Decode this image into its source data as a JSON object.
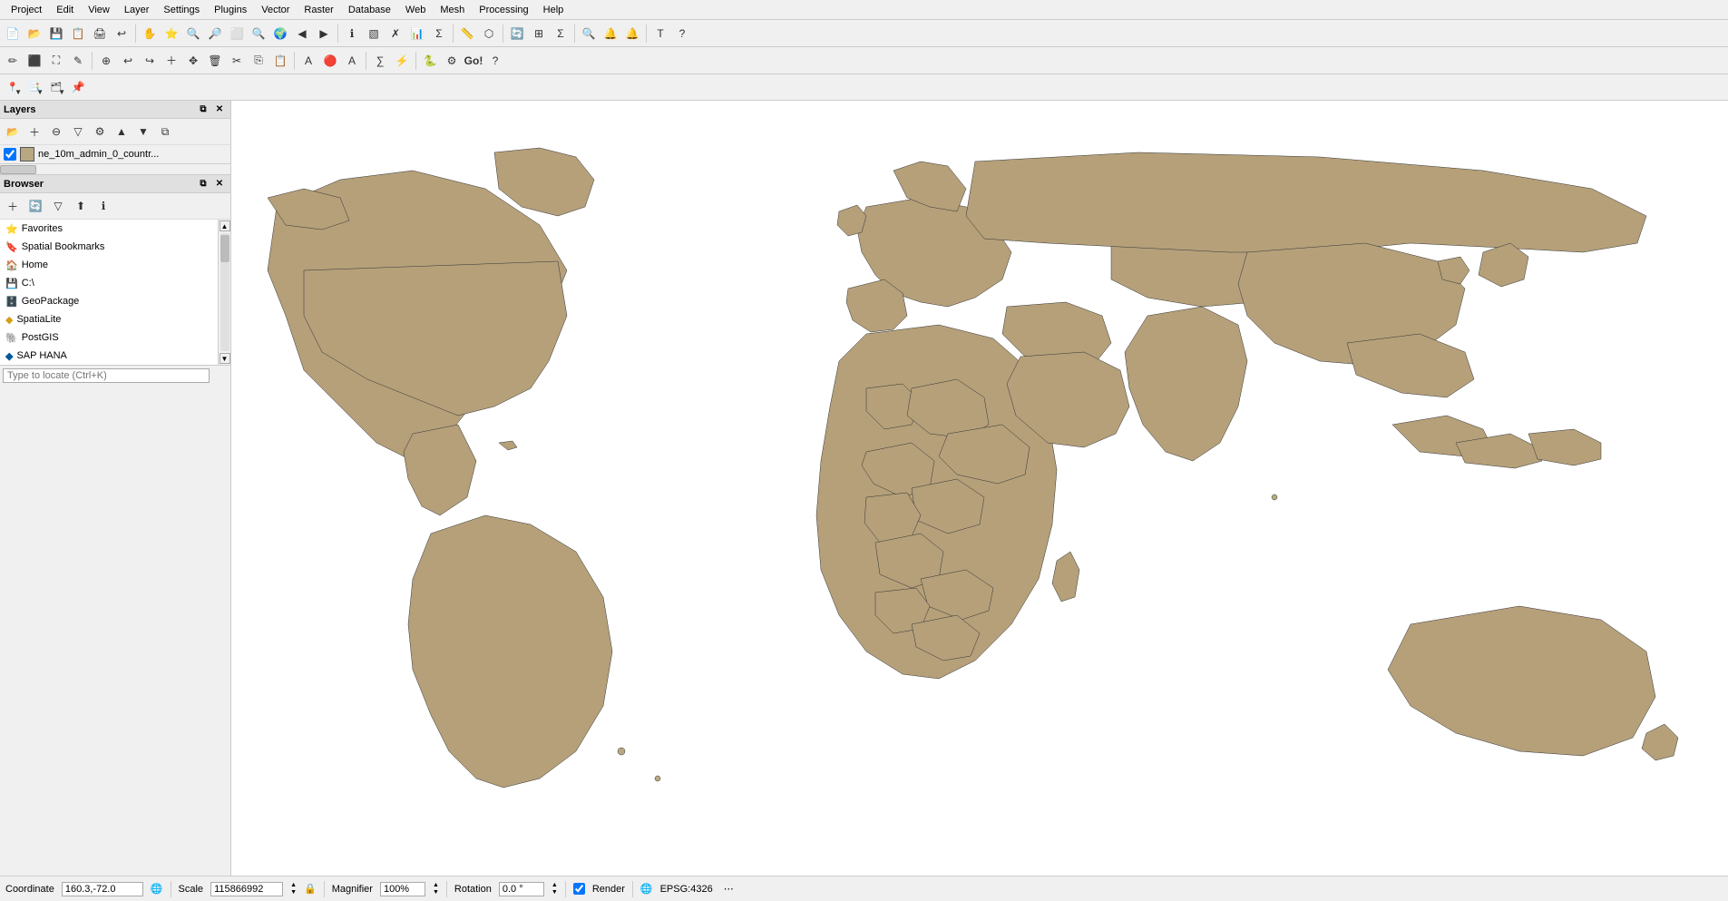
{
  "menubar": {
    "items": [
      "Project",
      "Edit",
      "View",
      "Layer",
      "Settings",
      "Plugins",
      "Vector",
      "Raster",
      "Database",
      "Web",
      "Mesh",
      "Processing",
      "Help"
    ]
  },
  "layers_panel": {
    "title": "Layers",
    "layer": {
      "checked": true,
      "color": "#b8a882",
      "name": "ne_10m_admin_0_countr..."
    }
  },
  "browser_panel": {
    "title": "Browser",
    "items": [
      {
        "icon": "star",
        "label": "Favorites"
      },
      {
        "icon": "bookmark",
        "label": "Spatial Bookmarks"
      },
      {
        "icon": "home",
        "label": "Home"
      },
      {
        "icon": "drive",
        "label": "C:\\"
      },
      {
        "icon": "db",
        "label": "GeoPackage"
      },
      {
        "icon": "spatialite",
        "label": "SpatiaLite"
      },
      {
        "icon": "postgis",
        "label": "PostGIS"
      },
      {
        "icon": "saphana",
        "label": "SAP HANA"
      }
    ]
  },
  "locate": {
    "placeholder": "Type to locate (Ctrl+K)"
  },
  "statusbar": {
    "coordinate_label": "Coordinate",
    "coordinate_value": "160.3,-72.0",
    "scale_label": "Scale",
    "scale_value": "115866992",
    "magnifier_label": "Magnifier",
    "magnifier_value": "100%",
    "rotation_label": "Rotation",
    "rotation_value": "0.0 °",
    "render_label": "Render",
    "epsg_label": "EPSG:4326"
  },
  "toolbar": {
    "btns": [
      "🖐",
      "⭐",
      "🔍",
      "🔍",
      "🔲",
      "🔍",
      "🔍",
      "🗺",
      "🖨",
      "📋",
      "💾",
      "🔄",
      "⊕",
      "⊞",
      "Σ",
      "▦",
      "☰",
      "∑",
      "🔍",
      "🔔",
      "🔔",
      "T",
      "?"
    ]
  }
}
